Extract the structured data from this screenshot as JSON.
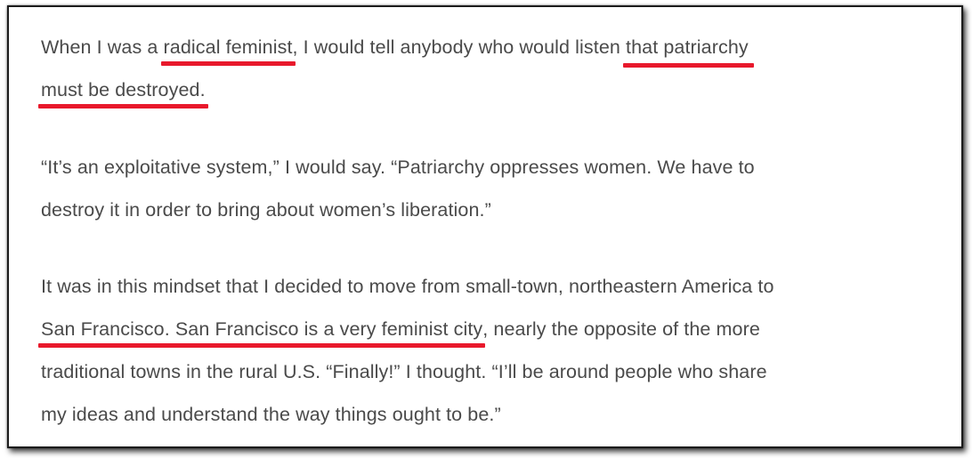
{
  "paragraphs": [
    {
      "lines": [
        {
          "before": "When I was a ",
          "highlight": "radical feminist",
          "after": ", I would tell anybody who would listen ",
          "highlight2": "that patriarchy",
          "after2": ""
        },
        {
          "before": "",
          "highlight": "must be destroyed",
          "after": ".",
          "highlight2": "",
          "after2": ""
        }
      ]
    },
    {
      "lines": [
        {
          "text": "“It’s an exploitative system,” I would say. “Patriarchy oppresses women. We have to"
        },
        {
          "text": "destroy it in order to bring about women’s liberation.”"
        }
      ]
    },
    {
      "lines": [
        {
          "text": "It was in this mindset that I decided to move from small-town, northeastern America to"
        },
        {
          "before": "",
          "highlight": "San Francisco. San Francisco is a very feminist city",
          "after": ", nearly the opposite of the more"
        },
        {
          "text": "traditional towns in the rural U.S. “Finally!” I thought. “I’ll be around people who share"
        },
        {
          "text": "my ideas and understand the way things ought to be.”"
        }
      ]
    }
  ],
  "colors": {
    "text": "#4a4a4a",
    "underline": "#e8192c",
    "border": "#1c1c1c"
  }
}
